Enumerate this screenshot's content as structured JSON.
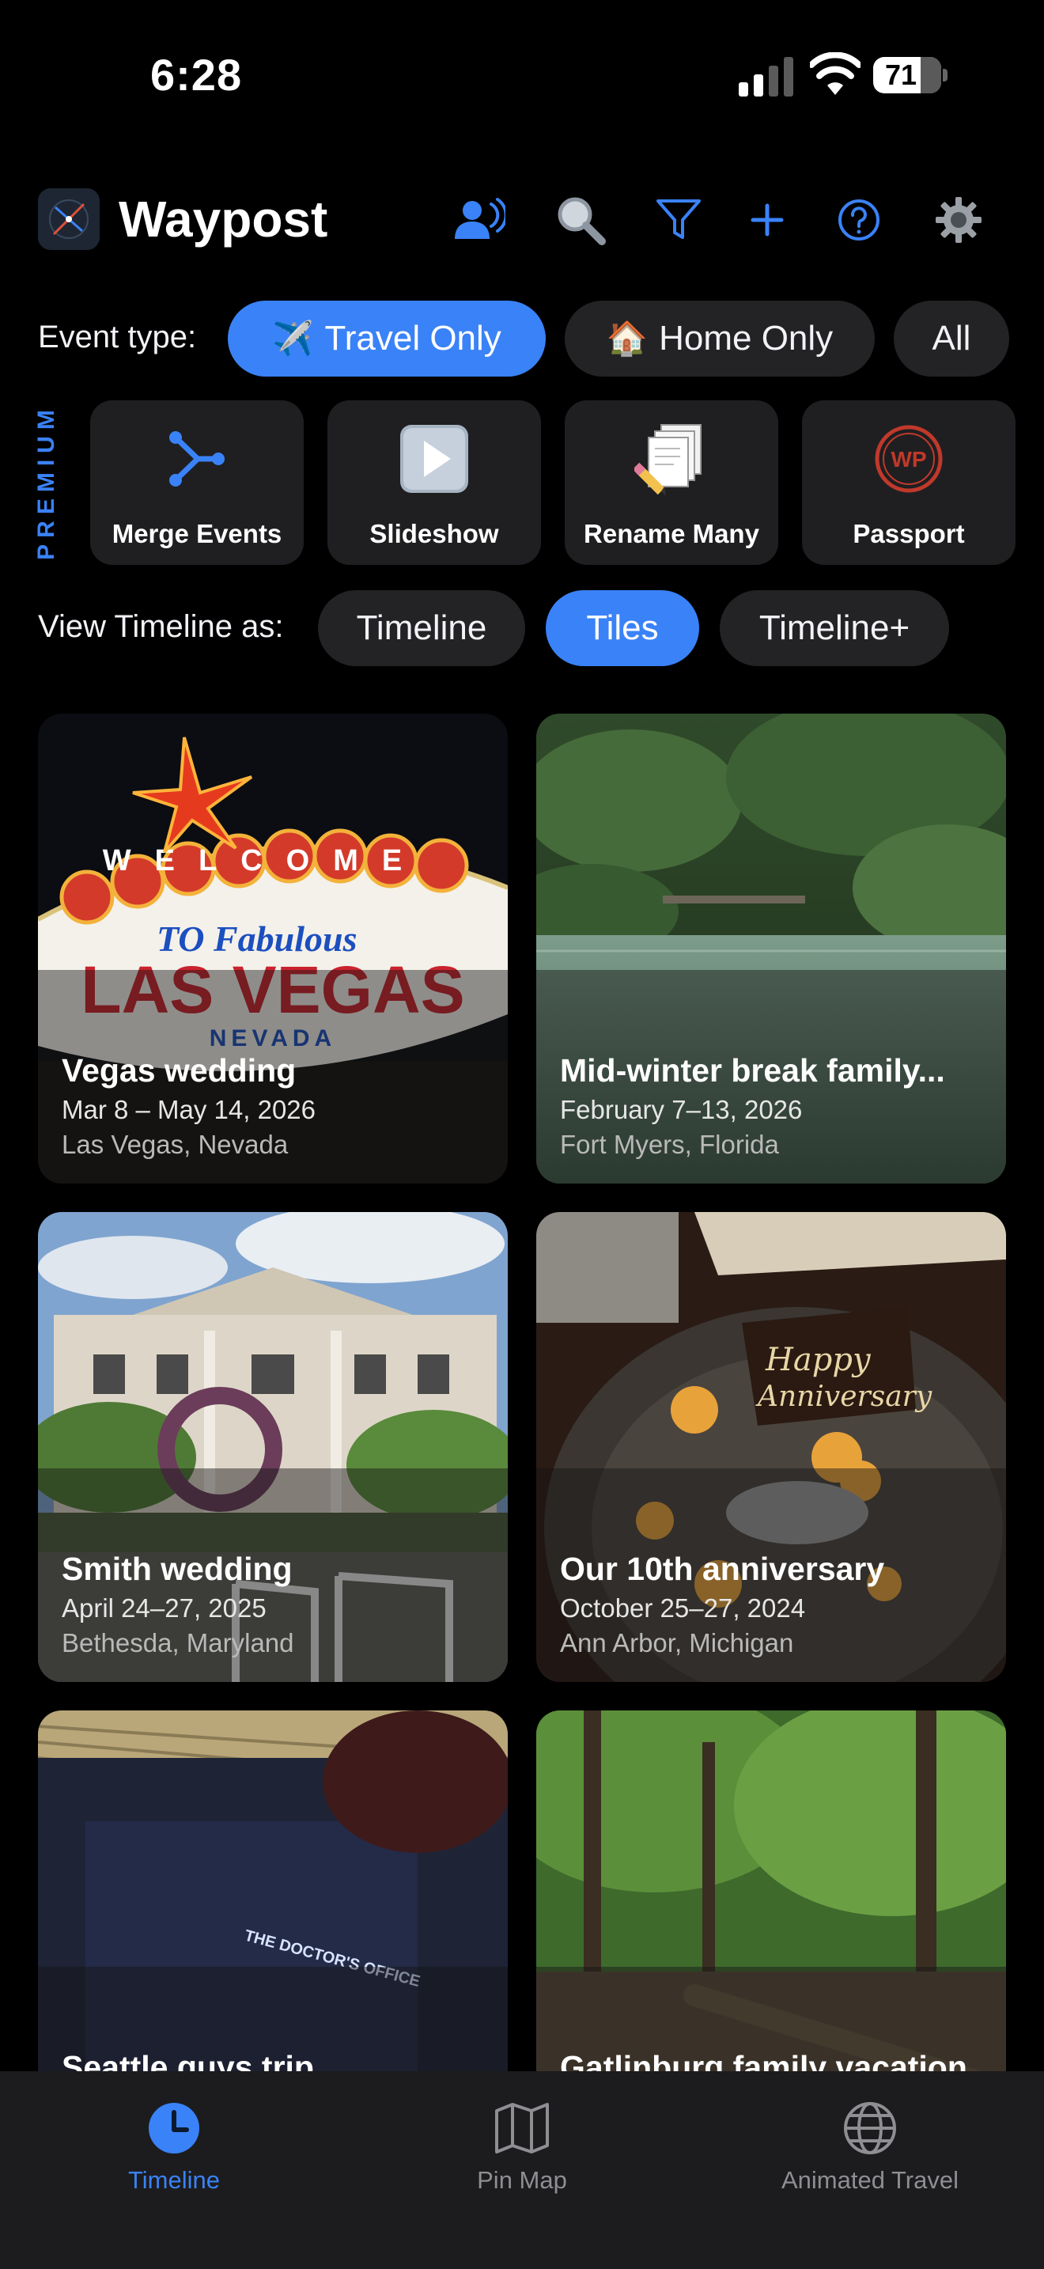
{
  "status_bar": {
    "time": "6:28",
    "battery": "71"
  },
  "header": {
    "app_name": "Waypost",
    "buttons": [
      "voice-icon",
      "search-icon",
      "filter-icon",
      "plus-icon",
      "help-icon",
      "gear-icon"
    ]
  },
  "event_type": {
    "label": "Event type:",
    "options": [
      {
        "emoji": "✈️",
        "label": "Travel Only",
        "selected": true
      },
      {
        "emoji": "🏠",
        "label": "Home Only",
        "selected": false
      },
      {
        "emoji": "",
        "label": "All",
        "selected": false
      }
    ]
  },
  "premium": {
    "label": "PREMIUM",
    "items": [
      {
        "label": "Merge Events",
        "icon": "merge-icon"
      },
      {
        "label": "Slideshow",
        "icon": "play-icon"
      },
      {
        "label": "Rename Many",
        "icon": "rename-icon"
      },
      {
        "label": "Passport",
        "icon": "wp-stamp-icon",
        "stamp": "WP"
      }
    ]
  },
  "view": {
    "label": "View Timeline as:",
    "options": [
      {
        "label": "Timeline",
        "selected": false
      },
      {
        "label": "Tiles",
        "selected": true
      },
      {
        "label": "Timeline+",
        "selected": false
      }
    ]
  },
  "events": [
    {
      "title": "Vegas wedding",
      "dates": "Mar 8 – May 14, 2026",
      "location": "Las Vegas, Nevada"
    },
    {
      "title": "Mid-winter break family...",
      "dates": "February 7–13, 2026",
      "location": "Fort Myers, Florida"
    },
    {
      "title": "Smith wedding",
      "dates": "April 24–27, 2025",
      "location": "Bethesda, Maryland"
    },
    {
      "title": "Our 10th anniversary",
      "dates": "October 25–27, 2024",
      "location": "Ann Arbor, Michigan"
    },
    {
      "title": "Seattle guys trip",
      "dates": "",
      "location": ""
    },
    {
      "title": "Gatlinburg family vacation",
      "dates": "",
      "location": ""
    }
  ],
  "sign_text": {
    "welcome": "WELCOME",
    "to_fabulous": "TO Fabulous",
    "las_vegas": "LAS VEGAS",
    "nevada": "NEVADA",
    "happy": "Happy",
    "anniversary": "Anniversary",
    "door_sign": "THE DOCTOR'S OFFICE"
  },
  "tabs": [
    {
      "label": "Timeline",
      "icon": "clock-icon",
      "active": true
    },
    {
      "label": "Pin Map",
      "icon": "map-icon",
      "active": false
    },
    {
      "label": "Animated Travel",
      "icon": "globe-icon",
      "active": false
    }
  ],
  "colors": {
    "accent": "#3a82f7",
    "background": "#000000",
    "chip": "#232325",
    "card": "#1f1f21",
    "tab_bar": "#1c1c1e"
  }
}
